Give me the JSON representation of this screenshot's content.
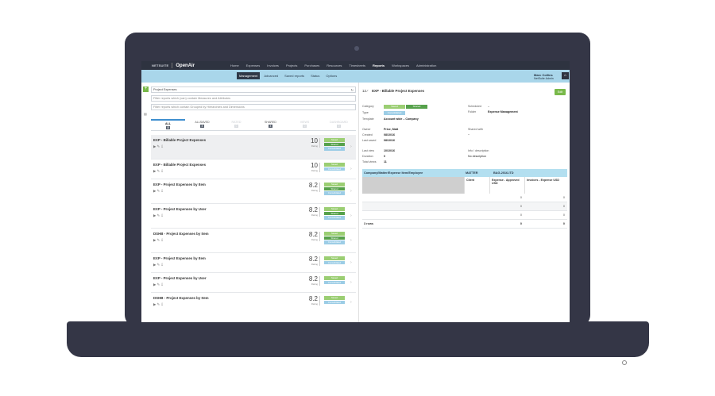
{
  "nav": {
    "logo_ns": "NETSUITE",
    "logo_oa": "OpenAir",
    "items": [
      "Home",
      "Expenses",
      "Invoices",
      "Projects",
      "Purchases",
      "Resources",
      "Timesheets",
      "Reports",
      "Workspaces",
      "Administration"
    ],
    "active": "Reports"
  },
  "subnav": {
    "tabs": [
      "Management",
      "Advanced",
      "Saved reports",
      "Status",
      "Options"
    ],
    "user_name": "Marc Collins",
    "user_role": "NetSuite Admin",
    "home_icon": "home-icon"
  },
  "left": {
    "search_value": "Project Expenses",
    "filter1_placeholder": "Filter reports which (can) contain Measures and Attributes",
    "filter2_placeholder": "Filter reports which contain Grouped by Hierarchies and Dimensions",
    "filter_tabs": [
      {
        "label": "ALL",
        "count": "8"
      },
      {
        "label": "ALLSAVED",
        "count": "8"
      },
      {
        "label": "RATED",
        "count": "0"
      },
      {
        "label": "SHARED",
        "count": "4"
      },
      {
        "label": "VIEWS",
        "count": "0"
      },
      {
        "label": "DASHBOARD",
        "count": "0"
      }
    ],
    "reports": [
      {
        "title": "EXP - Billable Project Expenses",
        "rating": "10",
        "rating_label": "Rating",
        "saved": "Saved",
        "shared": "Shared",
        "cons": "Consolidated"
      },
      {
        "title": "EXP - Billable Project Expenses",
        "rating": "10",
        "rating_label": "Rating",
        "saved": "Saved",
        "shared": "",
        "cons": "Consolidated"
      },
      {
        "title": "EXP - Project Expenses by Item",
        "rating": "8.2",
        "rating_label": "Rating",
        "saved": "Saved",
        "shared": "Shared",
        "cons": "Consolidated"
      },
      {
        "title": "EXP - Project Expenses by User",
        "rating": "8.2",
        "rating_label": "Rating",
        "saved": "Saved",
        "shared": "Shared",
        "cons": "Consolidated"
      },
      {
        "title": "DSHB - Project Expenses by Item",
        "rating": "8.2",
        "rating_label": "Rating",
        "saved": "Saved",
        "shared": "Shared",
        "cons": "Consolidated"
      },
      {
        "title": "EXP - Project Expenses by Item",
        "rating": "8.2",
        "rating_label": "Rating",
        "saved": "Saved",
        "shared": "",
        "cons": "Consolidated"
      },
      {
        "title": "EXP - Project Expenses by User",
        "rating": "8.2",
        "rating_label": "Rating",
        "saved": "Saved",
        "shared": "",
        "cons": "Consolidated"
      },
      {
        "title": "DSHB - Project Expenses by Item",
        "rating": "8.2",
        "rating_label": "Rating",
        "saved": "Saved",
        "shared": "",
        "cons": "Consolidated"
      }
    ]
  },
  "right": {
    "report_id": "12",
    "report_title": "EXP - Billable Project Expenses",
    "edit_label": "Edit",
    "category_label": "Category",
    "category_saved": "Saved",
    "category_shared": "Shared",
    "type_label": "Type",
    "type_value": "Consolidated",
    "template_label": "Template",
    "template_value": "Account wide – Company",
    "owner_label": "Owner",
    "owner_value": "Price, Matt",
    "created_label": "Created",
    "created_value": "08/10/16",
    "last_saved_label": "Last saved",
    "last_saved_value": "08/10/16",
    "last_view_label": "Last view",
    "last_view_value": "10/10/16",
    "duration_label": "Duration",
    "duration_value": "0",
    "total_views_label": "Total views",
    "total_views_value": "11",
    "scheduled_label": "Scheduled",
    "scheduled_value": "–",
    "folder_label": "Folder",
    "folder_value": "Expense Management",
    "shared_with_label": "Shared with",
    "shared_with_value": "–",
    "info_label": "Info / description",
    "info_value": "No description",
    "table": {
      "h1": "Company/Matter/Expense Item/Employee",
      "h2": "MATTER",
      "h3": "BAG-2016-ITD",
      "sub_client": "Client",
      "sub_approved": "Expense - Approved USD",
      "sub_invoices": "Invoices - Expense USD",
      "rows": [
        {
          "a": "",
          "b": "0",
          "c": "0"
        },
        {
          "a": "",
          "b": "0",
          "c": "0"
        },
        {
          "a": "",
          "b": "0",
          "c": "0"
        }
      ],
      "footer_rows": "3 rows",
      "footer_b": "0",
      "footer_c": "0"
    }
  },
  "colors": {
    "nav_bg": "#2e3340",
    "subnav_bg": "#a9d6ea",
    "accent_green": "#79b94a",
    "shared_green": "#56a14b",
    "consolidated_blue": "#9ccde6"
  }
}
